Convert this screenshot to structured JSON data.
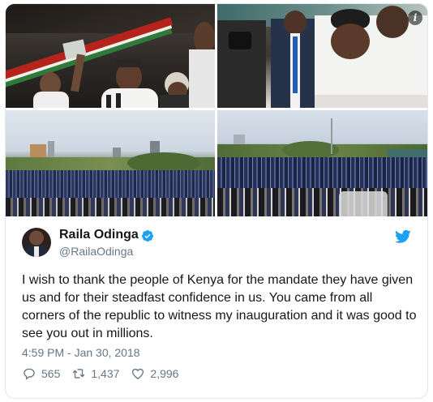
{
  "tweet": {
    "author_name": "Raila Odinga",
    "handle": "@RailaOdinga",
    "text": "I wish to thank the people of Kenya for the mandate they have given us and for their steadfast confidence in us. You came from all corners of the republic to witness my inauguration and it was good to see you out in millions.",
    "timestamp": "4:59 PM - Jan 30, 2018",
    "replies": "565",
    "retweets": "1,437",
    "likes": "2,996"
  },
  "icons": {
    "verified": "verified-badge-icon",
    "brand": "twitter-bird-icon",
    "reply": "reply-icon",
    "retweet": "retweet-icon",
    "like": "heart-icon",
    "media_info": "info-icon"
  },
  "colors": {
    "brand": "#1da1f2",
    "secondary_text": "#657786",
    "border": "#e1e8ed"
  }
}
